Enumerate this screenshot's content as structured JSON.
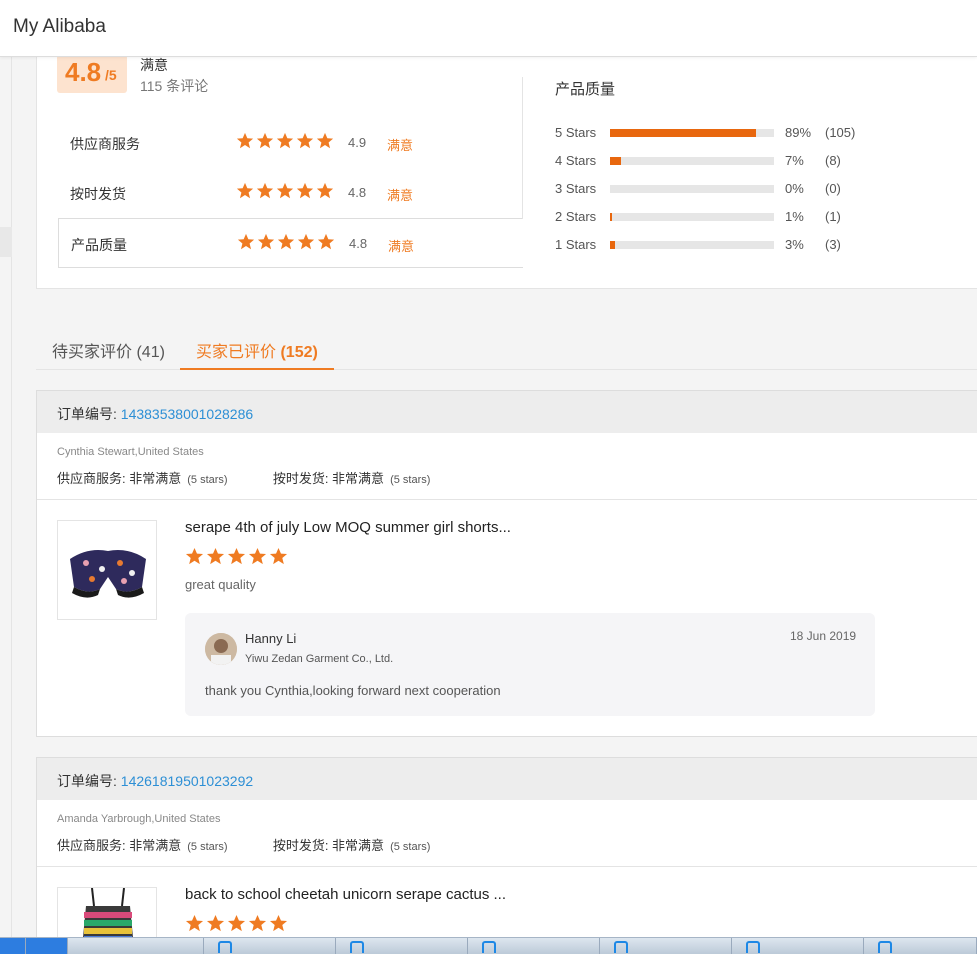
{
  "app": {
    "title": "My Alibaba"
  },
  "summary": {
    "score": "4.8",
    "score_suffix": "/5",
    "satisfaction": "满意",
    "review_count": "115 条评论",
    "metrics": [
      {
        "label": "供应商服务",
        "value": "4.9",
        "status": "满意",
        "stars": 5
      },
      {
        "label": "按时发货",
        "value": "4.8",
        "status": "满意",
        "stars": 5
      },
      {
        "label": "产品质量",
        "value": "4.8",
        "status": "满意",
        "stars": 5
      }
    ],
    "quality_title": "产品质量",
    "distribution": [
      {
        "label": "5  Stars",
        "fraction": 0.89,
        "pct": "89%",
        "count": "(105)"
      },
      {
        "label": "4  Stars",
        "fraction": 0.07,
        "pct": "7%",
        "count": "(8)"
      },
      {
        "label": "3  Stars",
        "fraction": 0.0,
        "pct": "0%",
        "count": "(0)"
      },
      {
        "label": "2  Stars",
        "fraction": 0.01,
        "pct": "1%",
        "count": "(1)"
      },
      {
        "label": "1  Stars",
        "fraction": 0.03,
        "pct": "3%",
        "count": "(3)"
      }
    ]
  },
  "tabs": [
    {
      "label": "待买家评价",
      "count": "(41)",
      "active": false
    },
    {
      "label": "买家已评价",
      "count": "(152)",
      "active": true
    }
  ],
  "orders": [
    {
      "order_label": "订单编号:",
      "order_number": "14383538001028286",
      "buyer": "Cynthia Stewart,United States",
      "service_label": "供应商服务: 非常满意",
      "service_stars": "(5 stars)",
      "delivery_label": "按时发货: 非常满意",
      "delivery_stars": "(5 stars)",
      "product_title": "serape 4th of july Low MOQ summer girl shorts...",
      "rating": 5,
      "comment": "great quality",
      "reply": {
        "name": "Hanny Li",
        "company": "Yiwu Zedan Garment Co., Ltd.",
        "date": "18 Jun 2019",
        "text": "thank you Cynthia,looking forward next cooperation"
      }
    },
    {
      "order_label": "订单编号:",
      "order_number": "14261819501023292",
      "buyer": "Amanda Yarbrough,United States",
      "service_label": "供应商服务: 非常满意",
      "service_stars": "(5 stars)",
      "delivery_label": "按时发货: 非常满意",
      "delivery_stars": "(5 stars)",
      "product_title": "back to school cheetah unicorn serape cactus ...",
      "rating": 5
    }
  ],
  "icons": {
    "star": "star-icon",
    "avatar": "avatar",
    "taskbar": "app-icon"
  },
  "colors": {
    "accent": "#ef7b22",
    "bar_fill": "#e8670e",
    "link": "#2d8fd5"
  }
}
